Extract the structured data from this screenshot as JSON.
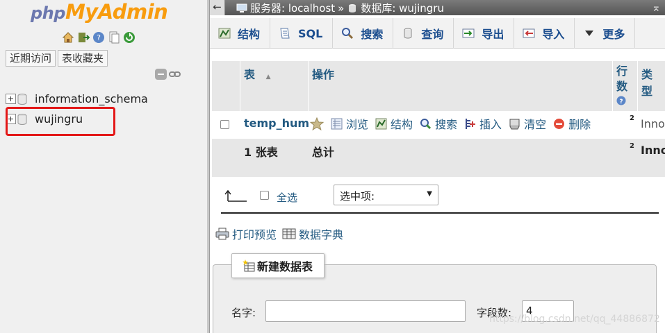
{
  "logo": {
    "php": "php",
    "myadmin": "MyAdmin"
  },
  "quick_icons": [
    "home-icon",
    "logout-icon",
    "help-icon",
    "docs-icon",
    "reload-icon"
  ],
  "nav_tabs": [
    "近期访问",
    "表收藏夹"
  ],
  "databases": [
    "information_schema",
    "wujingru"
  ],
  "topbar": {
    "back": "←",
    "server_label": "服务器: localhost",
    "separator": "»",
    "db_label": "数据库: wujingru",
    "collapse": "⌅"
  },
  "menu_tabs": [
    {
      "label": "结构",
      "icon": "structure-icon"
    },
    {
      "label": "SQL",
      "icon": "sql-icon"
    },
    {
      "label": "搜索",
      "icon": "search-icon"
    },
    {
      "label": "查询",
      "icon": "query-icon"
    },
    {
      "label": "导出",
      "icon": "export-icon"
    },
    {
      "label": "导入",
      "icon": "import-icon"
    },
    {
      "label": "更多",
      "icon": "more-icon"
    }
  ],
  "table": {
    "headers": {
      "table": "表",
      "sort": "▲",
      "actions": "操作",
      "rows": "行数",
      "type": "类型"
    },
    "rows": [
      {
        "name": "temp_hum",
        "actions": [
          "浏览",
          "结构",
          "搜索",
          "插入",
          "清空",
          "删除"
        ],
        "rows": "2",
        "engine": "Inno"
      }
    ],
    "footer": {
      "count": "1 张表",
      "sum": "总计",
      "rows": "2",
      "engine": "Inno"
    }
  },
  "check_all": {
    "label": "全选",
    "with_selected": "选中项:"
  },
  "extras": {
    "print": "打印预览",
    "dict": "数据字典"
  },
  "new_table": {
    "legend": "新建数据表",
    "name_label": "名字:",
    "name_value": "",
    "cols_label": "字段数:",
    "cols_value": "4"
  },
  "watermark": "https://blog.csdn.net/qq_44886872"
}
